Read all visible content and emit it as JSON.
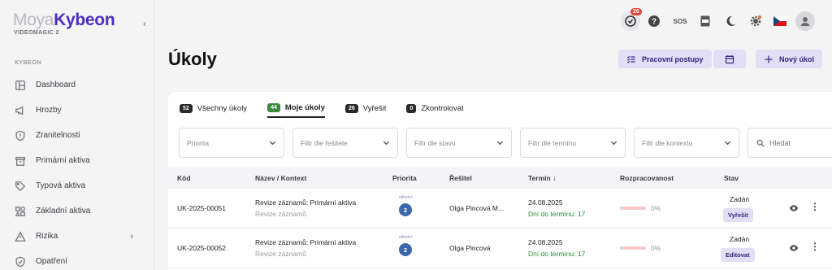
{
  "brand": {
    "part1": "Moya",
    "part2": "Kybeon",
    "subtitle": "VIDEOMAGIC 2"
  },
  "sidebar": {
    "section": "KYBEON",
    "items": [
      {
        "label": "Dashboard",
        "icon": "dashboard-icon"
      },
      {
        "label": "Hrozby",
        "icon": "megaphone-icon"
      },
      {
        "label": "Zranitelnosti",
        "icon": "shield-icon"
      },
      {
        "label": "Primární aktiva",
        "icon": "box-icon"
      },
      {
        "label": "Typová aktiva",
        "icon": "tag-icon"
      },
      {
        "label": "Základní aktiva",
        "icon": "shapes-icon"
      },
      {
        "label": "Rizika",
        "icon": "warning-icon"
      },
      {
        "label": "Opatření",
        "icon": "shield-check-icon"
      }
    ]
  },
  "topbar": {
    "tasks_badge": "26",
    "sos_label": "SOS"
  },
  "page": {
    "title": "Úkoly"
  },
  "actions": {
    "workflows": "Pracovní postupy",
    "new_task": "Nový úkol"
  },
  "tabs": [
    {
      "count": "52",
      "label": "Všechny úkoly"
    },
    {
      "count": "44",
      "label": "Moje úkoly"
    },
    {
      "count": "26",
      "label": "Vyřešit"
    },
    {
      "count": "0",
      "label": "Zkontrolovat"
    }
  ],
  "filters": {
    "priority": "Priorita",
    "solver": "Filtr dle řešitele",
    "state": "Filtr dle stavu",
    "deadline": "Filtr dle termínu",
    "context": "Filtr dle kontextu",
    "search": "Hledat"
  },
  "table": {
    "headers": {
      "code": "Kód",
      "name": "Název / Kontext",
      "priority": "Priorita",
      "solver": "Řešitel",
      "deadline": "Termín",
      "progress": "Rozpracovanost",
      "state": "Stav"
    },
    "rows": [
      {
        "code": "UK-2025-00051",
        "name": "Revize záznamů: Primární aktiva",
        "context": "Revize záznamů",
        "priority_label": "střední",
        "priority": "2",
        "solver": "Olga Pincová M...",
        "date": "24.08.2025",
        "days": "Dní do termínu: 17",
        "progress": "0%",
        "progress_value": 0,
        "state": "Zadán",
        "action": "Vyřešit"
      },
      {
        "code": "UK-2025-00052",
        "name": "Revize záznamů: Primární aktiva",
        "context": "Revize záznamů",
        "priority_label": "střední",
        "priority": "2",
        "solver": "Olga Pincová",
        "date": "24.08.2025",
        "days": "Dní do termínu: 17",
        "progress": "0%",
        "progress_value": 0,
        "state": "Zadán",
        "action": "Editovat"
      }
    ]
  }
}
